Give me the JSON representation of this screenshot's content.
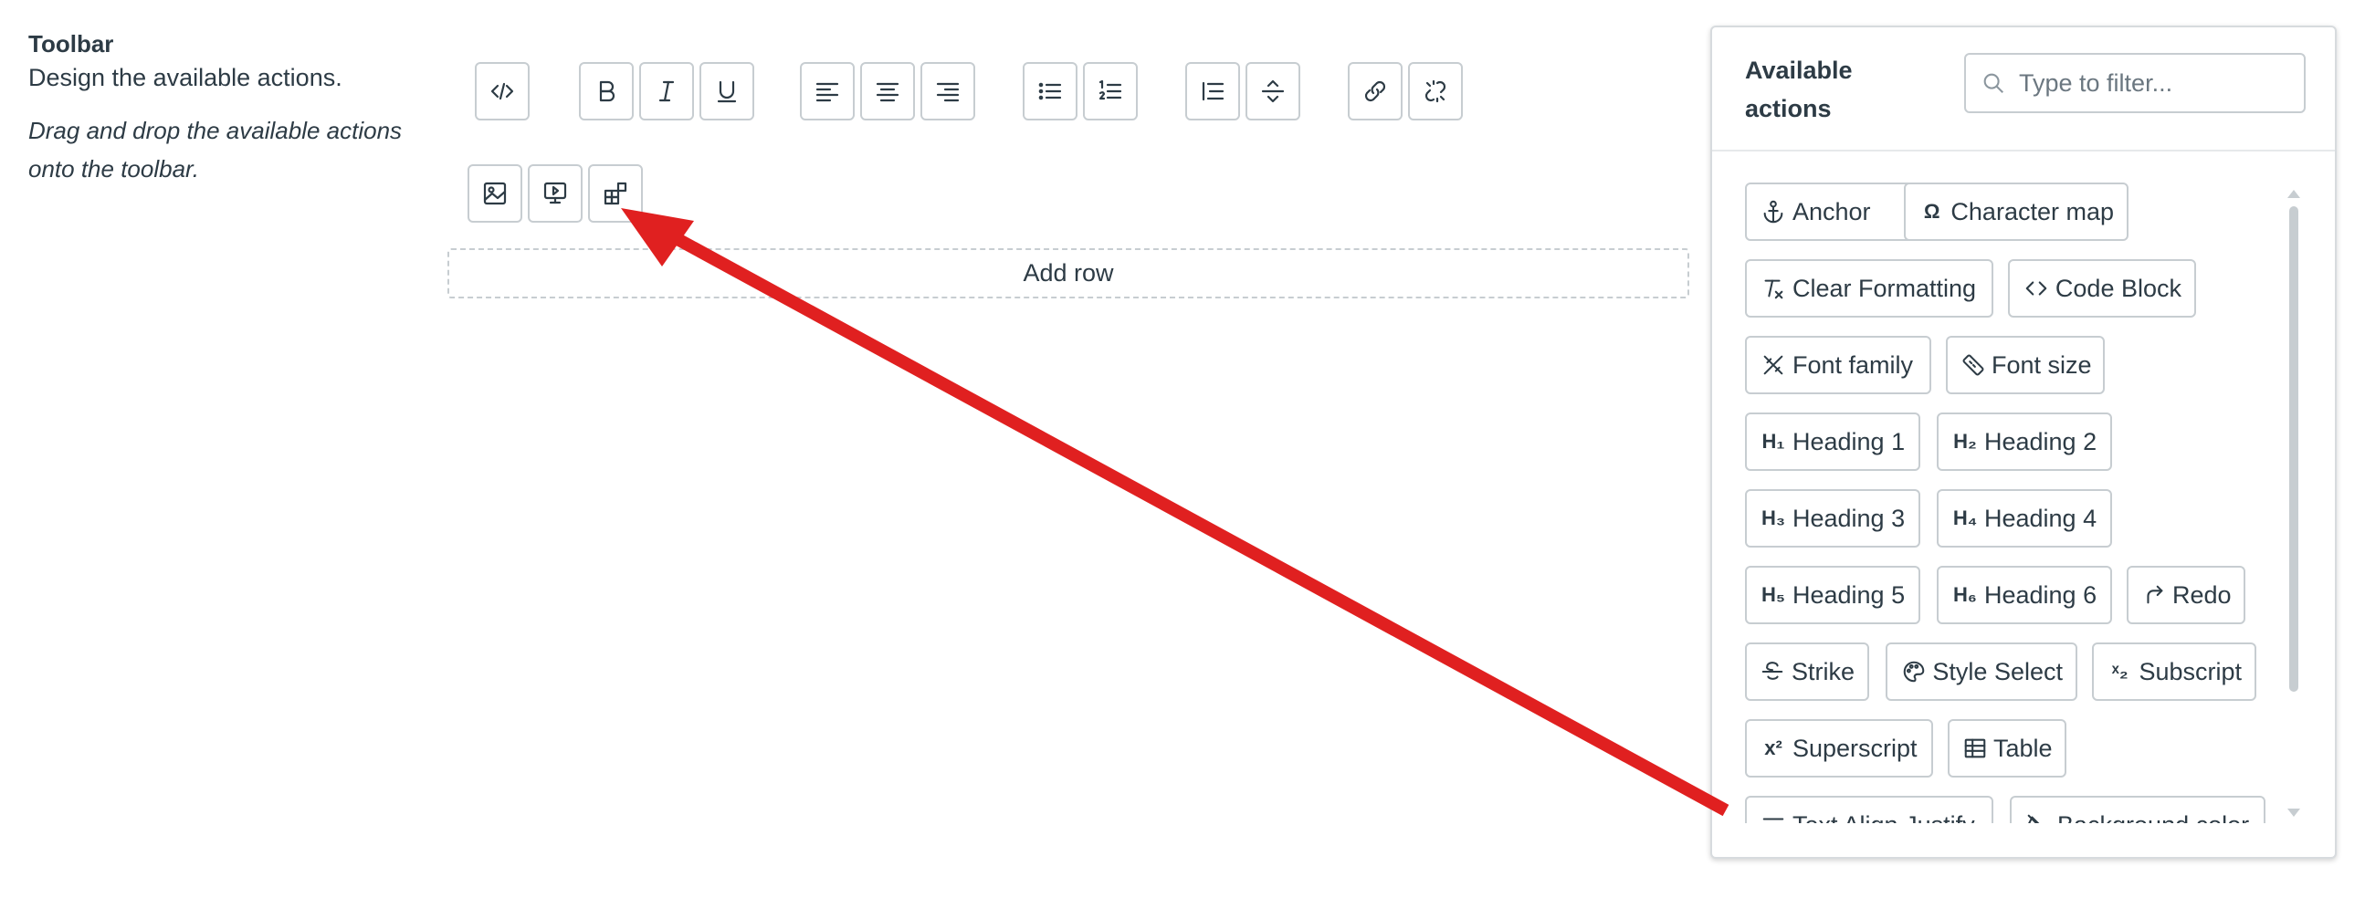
{
  "section": {
    "title": "Toolbar",
    "subtitle": "Design the available actions.",
    "hint": "Drag and drop the available actions onto the toolbar."
  },
  "toolbar": {
    "add_row_label": "Add row",
    "row1_icons": [
      "code-view-icon",
      "bold-icon",
      "italic-icon",
      "underline-icon",
      "align-left-icon",
      "align-center-icon",
      "align-right-icon",
      "bullet-list-icon",
      "numbered-list-icon",
      "indent-icon",
      "horizontal-rule-icon",
      "link-icon",
      "unlink-icon"
    ],
    "row2_icons": [
      "image-icon",
      "media-icon",
      "apps-icon"
    ]
  },
  "panel": {
    "title": "Available actions",
    "filter_placeholder": "Type to filter...",
    "actions": [
      {
        "label": "Anchor",
        "icon": "anchor-icon"
      },
      {
        "label": "Character map",
        "icon": "omega-icon"
      },
      {
        "label": "Clear Formatting",
        "icon": "clear-formatting-icon"
      },
      {
        "label": "Code Block",
        "icon": "code-icon"
      },
      {
        "label": "Font family",
        "icon": "font-family-icon"
      },
      {
        "label": "Font size",
        "icon": "font-size-icon"
      },
      {
        "label": "Heading 1",
        "icon": "h1-icon"
      },
      {
        "label": "Heading 2",
        "icon": "h2-icon"
      },
      {
        "label": "Heading 3",
        "icon": "h3-icon"
      },
      {
        "label": "Heading 4",
        "icon": "h4-icon"
      },
      {
        "label": "Heading 5",
        "icon": "h5-icon"
      },
      {
        "label": "Heading 6",
        "icon": "h6-icon"
      },
      {
        "label": "Redo",
        "icon": "redo-icon"
      },
      {
        "label": "Strike",
        "icon": "strike-icon"
      },
      {
        "label": "Style Select",
        "icon": "palette-icon"
      },
      {
        "label": "Subscript",
        "icon": "subscript-icon"
      },
      {
        "label": "Superscript",
        "icon": "superscript-icon"
      },
      {
        "label": "Table",
        "icon": "table-icon"
      },
      {
        "label": "Text Align Justify",
        "icon": "align-justify-icon"
      },
      {
        "label": "Background color",
        "icon": "background-color-icon"
      }
    ]
  },
  "colors": {
    "annotation_arrow": "#e02020",
    "border": "#c7cdd1",
    "text": "#2d3b45"
  }
}
